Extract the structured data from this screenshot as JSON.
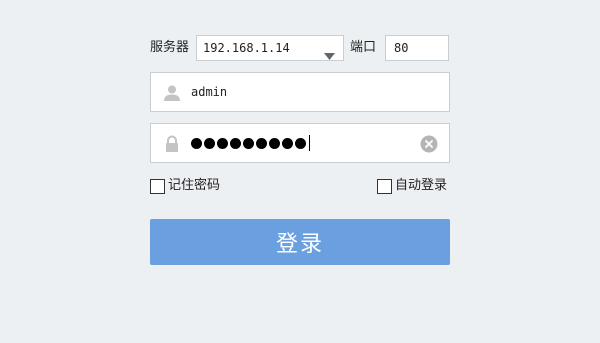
{
  "server": {
    "label": "服务器",
    "value": "192.168.1.14",
    "dropdown_icon": "caret-down-icon"
  },
  "port": {
    "label": "端口",
    "value": "80"
  },
  "username": {
    "value": "admin",
    "icon": "user-icon"
  },
  "password": {
    "masked_length": 9,
    "icon": "lock-icon",
    "clear_icon": "clear-circle-icon"
  },
  "options": {
    "remember_password": {
      "label": "记住密码",
      "checked": false
    },
    "auto_login": {
      "label": "自动登录",
      "checked": false
    }
  },
  "login_button": {
    "label": "登录",
    "color": "#6a9fe0"
  },
  "colors": {
    "background": "#edf0f3",
    "field_border": "#c9ced4"
  }
}
